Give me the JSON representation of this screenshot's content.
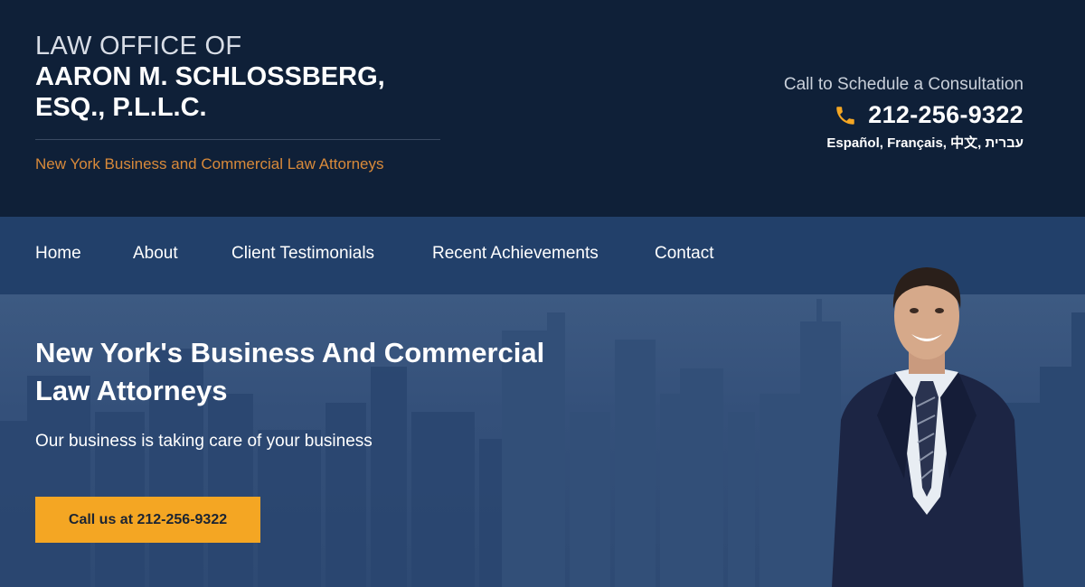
{
  "header": {
    "firm_line1": "LAW OFFICE OF",
    "firm_line2": "AARON M. SCHLOSSBERG,",
    "firm_line3": "ESQ., P.L.L.C.",
    "tagline": "New York Business and Commercial Law Attorneys",
    "call_label": "Call to Schedule a Consultation",
    "phone": "212-256-9322",
    "languages": "Español, Français, 中文, עברית"
  },
  "nav": {
    "items": [
      {
        "label": "Home"
      },
      {
        "label": "About"
      },
      {
        "label": "Client Testimonials"
      },
      {
        "label": "Recent Achievements"
      },
      {
        "label": "Contact"
      }
    ]
  },
  "hero": {
    "title_line1": "New York's Business And Commercial",
    "title_line2": "Law Attorneys",
    "subtitle": "Our business is taking care of your business",
    "cta_label": "Call us at 212-256-9322"
  },
  "colors": {
    "header_bg": "#0f2038",
    "nav_bg": "#22406a",
    "accent_orange": "#f4a623",
    "tagline_orange": "#d98a3a"
  },
  "icons": {
    "phone": "phone-icon",
    "attorney": "attorney-portrait"
  }
}
